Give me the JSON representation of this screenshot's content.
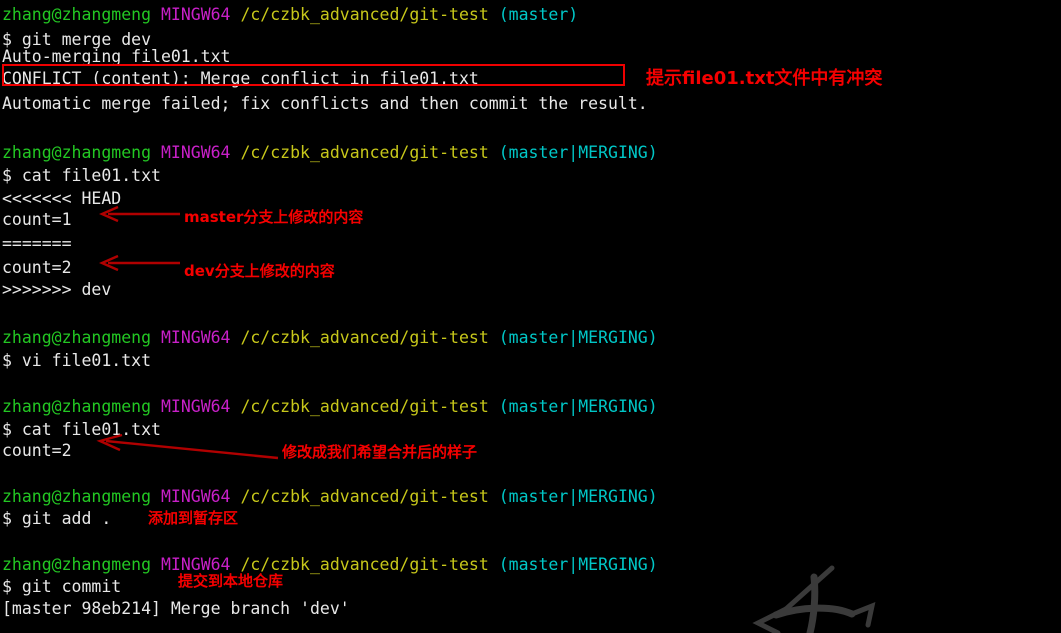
{
  "terminal": {
    "title": "Git Bash MINGW64 terminal",
    "background_color": "#000000",
    "foreground_color": "#d8d8d8",
    "colors": {
      "user_host": "#23c723",
      "mingw": "#c820c8",
      "path": "#c7c71a",
      "branch": "#00c7c7",
      "annotation_red": "#f50000",
      "box_red": "#ef0000"
    },
    "prompt": {
      "user_host": "zhang@zhangmeng",
      "shell": "MINGW64",
      "path": "/c/czbk_advanced/git-test",
      "branch_master": "(master)",
      "branch_merging": "(master|MERGING)",
      "sigil": "$"
    },
    "lines": [
      {
        "type": "prompt",
        "branch": "(master)"
      },
      {
        "type": "command",
        "text": "$ git merge dev"
      },
      {
        "type": "output",
        "text": "Auto-merging file01.txt"
      },
      {
        "type": "output",
        "text": "CONFLICT (content): Merge conflict in file01.txt"
      },
      {
        "type": "output",
        "text": "Automatic merge failed; fix conflicts and then commit the result."
      },
      {
        "type": "blank",
        "text": ""
      },
      {
        "type": "prompt",
        "branch": "(master|MERGING)"
      },
      {
        "type": "command",
        "text": "$ cat file01.txt"
      },
      {
        "type": "output",
        "text": "<<<<<<< HEAD"
      },
      {
        "type": "output",
        "text": "count=1"
      },
      {
        "type": "output",
        "text": "======="
      },
      {
        "type": "output",
        "text": "count=2"
      },
      {
        "type": "output",
        "text": ">>>>>>> dev"
      },
      {
        "type": "blank",
        "text": ""
      },
      {
        "type": "prompt",
        "branch": "(master|MERGING)"
      },
      {
        "type": "command",
        "text": "$ vi file01.txt"
      },
      {
        "type": "blank",
        "text": ""
      },
      {
        "type": "prompt",
        "branch": "(master|MERGING)"
      },
      {
        "type": "command",
        "text": "$ cat file01.txt"
      },
      {
        "type": "output",
        "text": "count=2"
      },
      {
        "type": "prompt",
        "branch": "(master|MERGING)"
      },
      {
        "type": "command",
        "text": "$ git add ."
      },
      {
        "type": "blank",
        "text": ""
      },
      {
        "type": "prompt",
        "branch": "(master|MERGING)"
      },
      {
        "type": "command",
        "text": "$ git commit"
      },
      {
        "type": "output",
        "text": "[master 98eb214] Merge branch 'dev'"
      }
    ],
    "text": {
      "cmd_git_merge_dev": "$ git merge dev",
      "out_auto_merging": "Auto-merging file01.txt",
      "out_conflict": "CONFLICT (content): Merge conflict in file01.txt",
      "out_auto_failed": "Automatic merge failed; fix conflicts and then commit the result.",
      "cmd_cat_1": "$ cat file01.txt",
      "out_head_marker": "<<<<<<< HEAD",
      "out_count1": "count=1",
      "out_sep_marker": "=======",
      "out_count2": "count=2",
      "out_dev_marker": ">>>>>>> dev",
      "cmd_vi": "$ vi file01.txt",
      "cmd_cat_2": "$ cat file01.txt",
      "out_count2b": "count=2",
      "cmd_git_add": "$ git add .",
      "cmd_git_commit": "$ git commit",
      "out_commit_result": "[master 98eb214] Merge branch 'dev'"
    }
  },
  "annotations": [
    {
      "id": "conflict-file-note",
      "text": "提示file01.txt文件中有冲突"
    },
    {
      "id": "master-branch-note",
      "text": "master分支上修改的内容"
    },
    {
      "id": "dev-branch-note",
      "text": "dev分支上修改的内容"
    },
    {
      "id": "desired-merge-note",
      "text": "修改成我们希望合并后的样子"
    },
    {
      "id": "add-to-stage-note",
      "text": "添加到暂存区"
    },
    {
      "id": "commit-to-repo-note",
      "text": "提交到本地仓库"
    }
  ]
}
